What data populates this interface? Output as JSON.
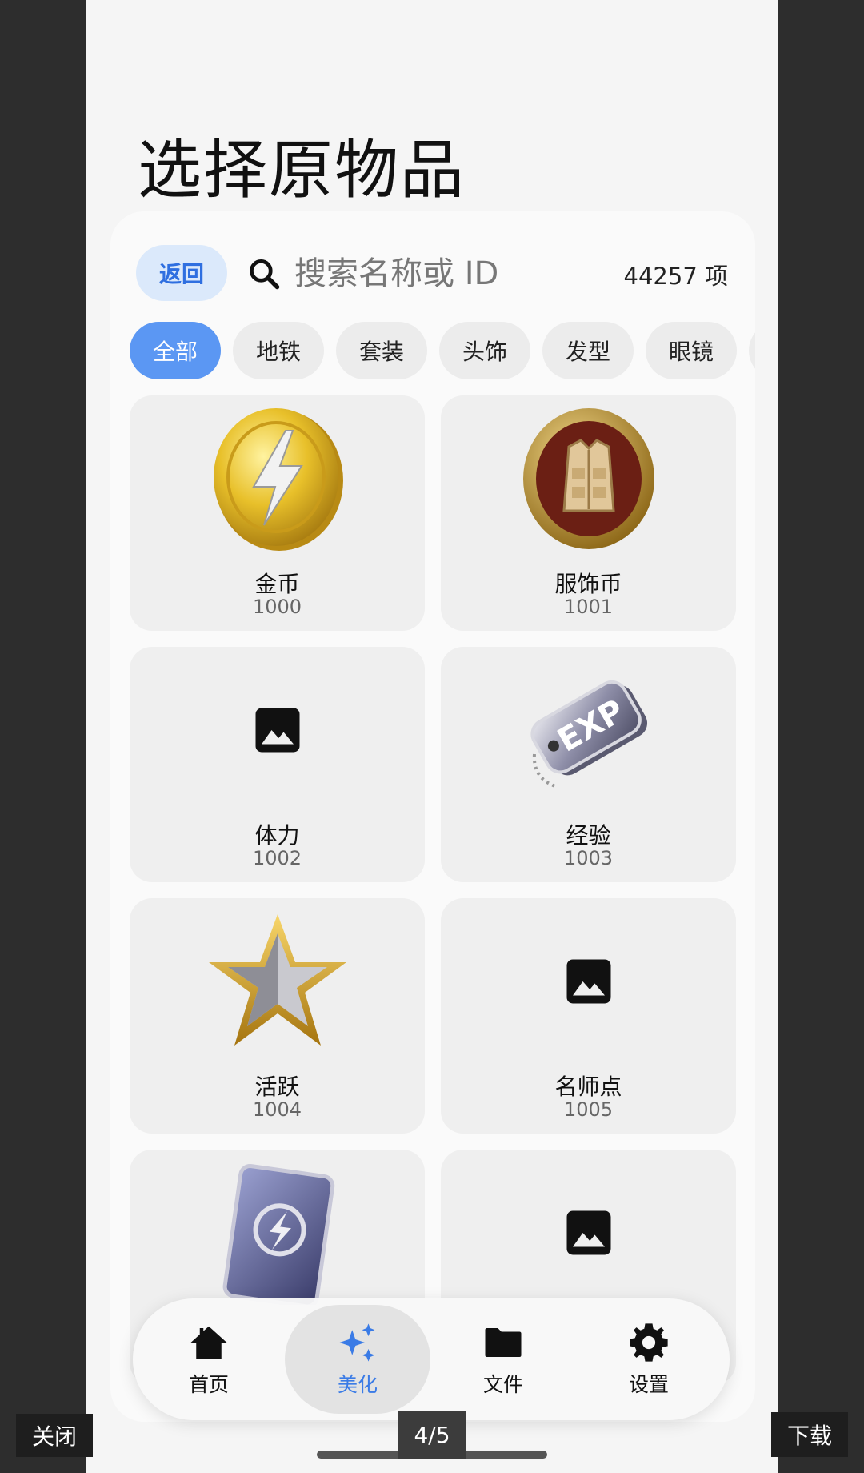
{
  "page_title": "选择原物品",
  "toolbar": {
    "back_label": "返回",
    "search_placeholder": "搜索名称或 ID",
    "count": "44257 项"
  },
  "categories": [
    "全部",
    "地铁",
    "套装",
    "头饰",
    "发型",
    "眼镜"
  ],
  "items": [
    {
      "name": "金币",
      "id": "1000",
      "icon": "gold-coin-icon"
    },
    {
      "name": "服饰币",
      "id": "1001",
      "icon": "costume-coin-icon"
    },
    {
      "name": "体力",
      "id": "1002",
      "icon": "image-placeholder-icon"
    },
    {
      "name": "经验",
      "id": "1003",
      "icon": "exp-tag-icon"
    },
    {
      "name": "活跃",
      "id": "1004",
      "icon": "gold-star-icon"
    },
    {
      "name": "名师点",
      "id": "1005",
      "icon": "image-placeholder-icon"
    },
    {
      "name": "",
      "id": "",
      "icon": "lightspeed-card-icon"
    },
    {
      "name": "",
      "id": "",
      "icon": "image-placeholder-icon"
    }
  ],
  "nav": {
    "home": "首页",
    "beautify": "美化",
    "files": "文件",
    "settings": "设置"
  },
  "overlay": {
    "close": "关闭",
    "page_indicator": "4/5",
    "download": "下载"
  },
  "colors": {
    "accent": "#3a7be6",
    "chip_active": "#5b97f3",
    "back_button_bg": "#dbe9fb"
  }
}
